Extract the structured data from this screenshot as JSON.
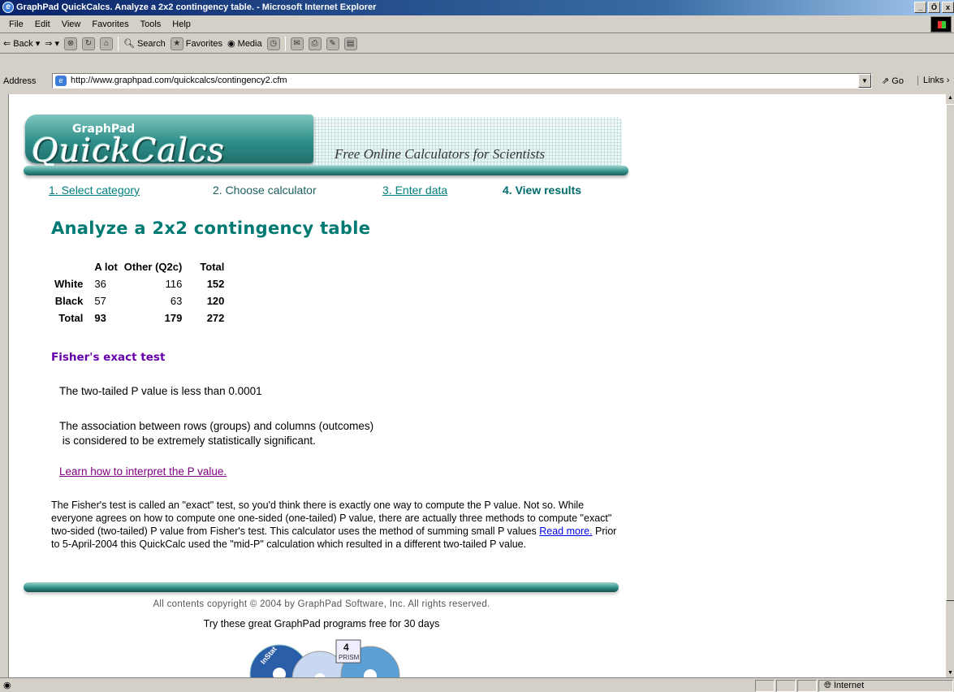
{
  "window": {
    "title": "GraphPad QuickCalcs. Analyze a 2x2 contingency table. - Microsoft Internet Explorer",
    "minimize": "_",
    "maximize": "Ő",
    "close": "x"
  },
  "menu": [
    "File",
    "Edit",
    "View",
    "Favorites",
    "Tools",
    "Help"
  ],
  "toolbar": {
    "back": "Back",
    "search": "Search",
    "favorites": "Favorites",
    "media": "Media"
  },
  "address": {
    "label": "Address",
    "url": "http://www.graphpad.com/quickcalcs/contingency2.cfm",
    "go": "Go",
    "links": "Links"
  },
  "banner": {
    "brand": "GraphPad",
    "product": "QuickCalcs",
    "tagline": "Free Online Calculators for Scientists"
  },
  "steps": [
    "1. Select category",
    "2. Choose calculator",
    "3. Enter data",
    "4. View results"
  ],
  "page_title": "Analyze a 2x2 contingency table",
  "table": {
    "headers": [
      "A lot",
      "Other (Q2c)",
      "Total"
    ],
    "rows": [
      {
        "label": "White",
        "a": "36",
        "b": "116",
        "total": "152"
      },
      {
        "label": "Black",
        "a": "57",
        "b": "63",
        "total": "120"
      },
      {
        "label": "Total",
        "a": "93",
        "b": "179",
        "total": "272"
      }
    ]
  },
  "fisher": {
    "heading": "Fisher's exact test",
    "pvalue": "The two-tailed P value is less than 0.0001",
    "assoc": "The association between rows (groups) and columns (outcomes)\n is considered to be extremely statistically significant.",
    "learn_link": "Learn how to interpret the P value.",
    "note_before": "The Fisher's test is called an \"exact\" test, so you'd think there is exactly one way to compute the P value. Not so. While everyone agrees on how to compute one one-sided (one-tailed) P value, there are actually three methods to compute \"exact\" two-sided (two-tailed) P value from Fisher's test. This calculator uses the method of summing small P values ",
    "read_more": "Read more.",
    "note_after": " Prior to 5-April-2004 this QuickCalc used the \"mid-P\" calculation which resulted in a different two-tailed P value."
  },
  "footer": {
    "copyright": "All contents copyright © 2004 by GraphPad Software, Inc. All rights reserved.",
    "try": "Try these great GraphPad programs free for 30 days",
    "cd_labels": [
      "InStat",
      "4",
      "PRISM"
    ]
  },
  "status": {
    "zone": "Internet"
  }
}
